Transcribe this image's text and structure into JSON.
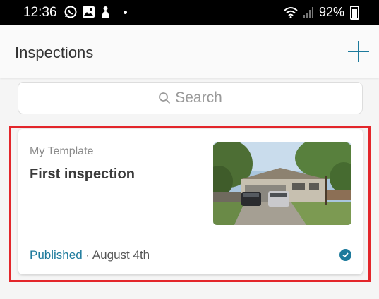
{
  "status_bar": {
    "time": "12:36",
    "battery_percent": "92%",
    "icons": [
      "whatsapp-icon",
      "gallery-icon",
      "notification-icon",
      "wifi-icon",
      "signal-icon",
      "battery-icon"
    ]
  },
  "header": {
    "title": "Inspections",
    "add_icon": "plus-icon",
    "accent_color": "#1d7a9c"
  },
  "search": {
    "placeholder": "Search"
  },
  "inspection_card": {
    "template": "My Template",
    "name": "First inspection",
    "status": "Published",
    "separator": " · ",
    "date": "August 4th",
    "checked": true,
    "thumbnail": "house-photo"
  },
  "colors": {
    "accent": "#1d7a9c",
    "highlight": "#e3262b"
  }
}
